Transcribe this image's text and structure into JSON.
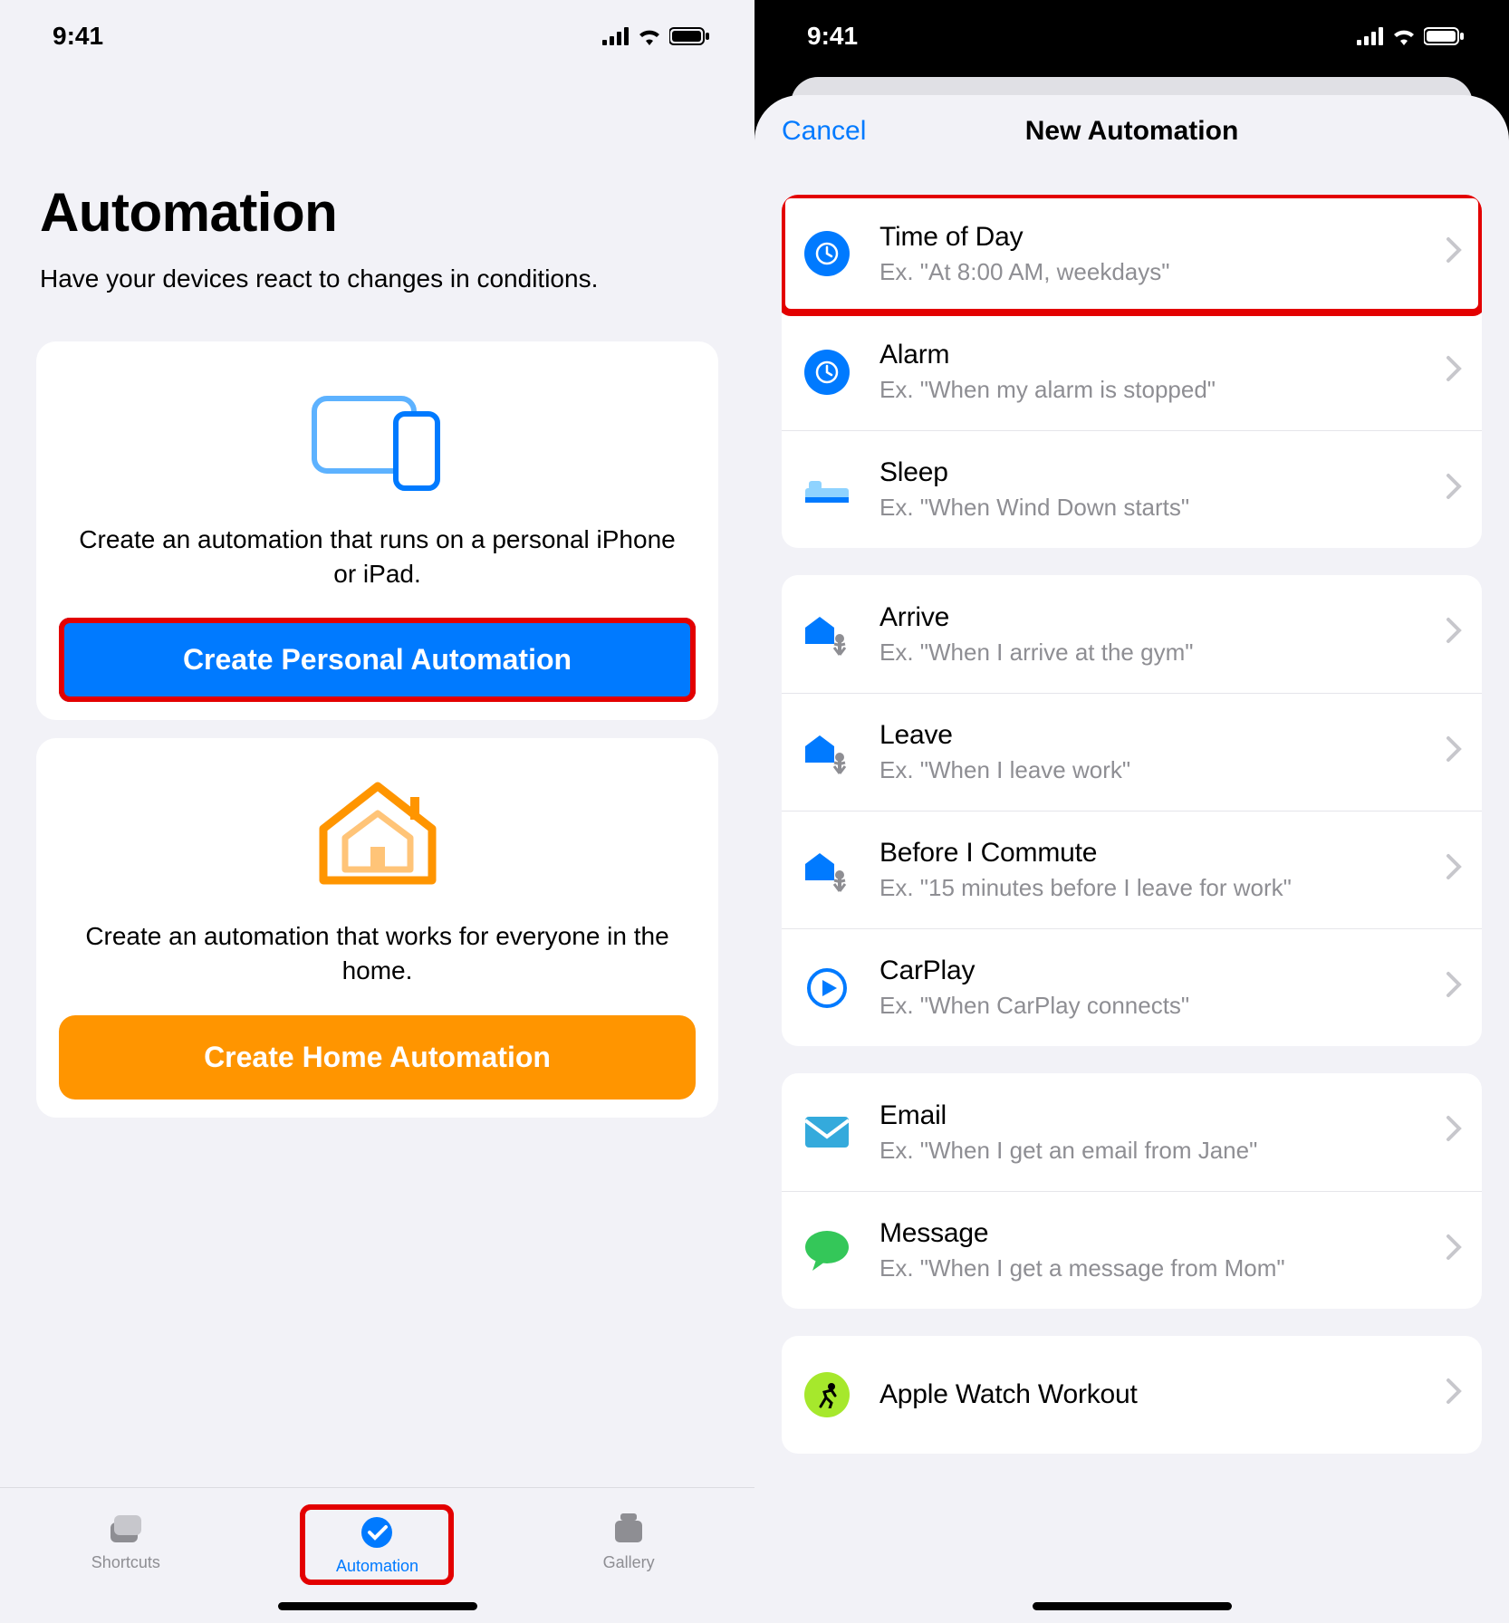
{
  "status": {
    "time": "9:41"
  },
  "left": {
    "title": "Automation",
    "subtitle": "Have your devices react to changes in conditions.",
    "personal": {
      "desc": "Create an automation that runs on a personal iPhone or iPad.",
      "button": "Create Personal Automation"
    },
    "home": {
      "desc": "Create an automation that works for everyone in the home.",
      "button": "Create Home Automation"
    },
    "tabs": {
      "shortcuts": "Shortcuts",
      "automation": "Automation",
      "gallery": "Gallery"
    }
  },
  "right": {
    "cancel": "Cancel",
    "title": "New Automation",
    "groups": [
      {
        "rows": [
          {
            "title": "Time of Day",
            "sub": "Ex. \"At 8:00 AM, weekdays\"",
            "icon": "clock-icon",
            "highlight": true
          },
          {
            "title": "Alarm",
            "sub": "Ex. \"When my alarm is stopped\"",
            "icon": "alarm-icon"
          },
          {
            "title": "Sleep",
            "sub": "Ex. \"When Wind Down starts\"",
            "icon": "bed-icon"
          }
        ]
      },
      {
        "rows": [
          {
            "title": "Arrive",
            "sub": "Ex. \"When I arrive at the gym\"",
            "icon": "arrive-icon"
          },
          {
            "title": "Leave",
            "sub": "Ex. \"When I leave work\"",
            "icon": "leave-icon"
          },
          {
            "title": "Before I Commute",
            "sub": "Ex. \"15 minutes before I leave for work\"",
            "icon": "commute-icon"
          },
          {
            "title": "CarPlay",
            "sub": "Ex. \"When CarPlay connects\"",
            "icon": "carplay-icon"
          }
        ]
      },
      {
        "rows": [
          {
            "title": "Email",
            "sub": "Ex. \"When I get an email from Jane\"",
            "icon": "email-icon"
          },
          {
            "title": "Message",
            "sub": "Ex. \"When I get a message from Mom\"",
            "icon": "message-icon"
          }
        ]
      },
      {
        "rows": [
          {
            "title": "Apple Watch Workout",
            "sub": "",
            "icon": "workout-icon"
          }
        ]
      }
    ]
  }
}
